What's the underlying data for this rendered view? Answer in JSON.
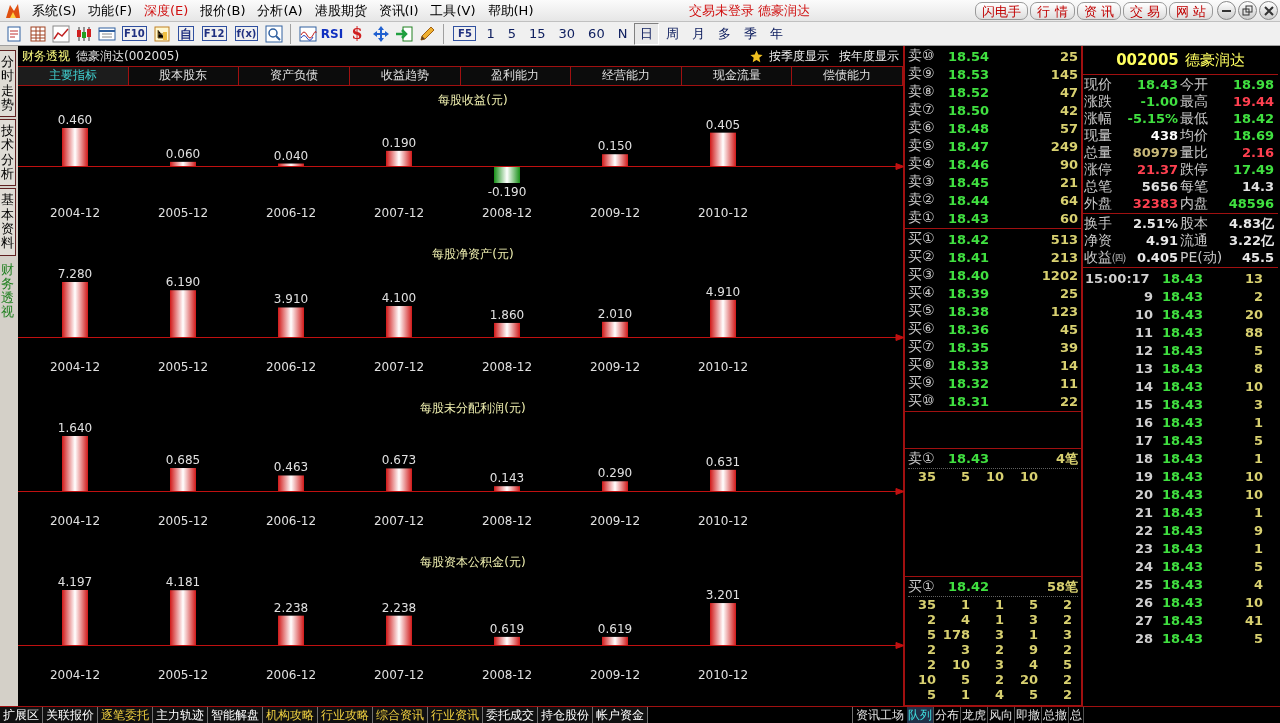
{
  "menu_bar": {
    "items": [
      {
        "label": "系统(S)",
        "highlighted": false
      },
      {
        "label": "功能(F)",
        "highlighted": false
      },
      {
        "label": "深度(E)",
        "highlighted": true
      },
      {
        "label": "报价(B)",
        "highlighted": false
      },
      {
        "label": "分析(A)",
        "highlighted": false
      },
      {
        "label": "港股期货",
        "highlighted": false
      },
      {
        "label": "资讯(I)",
        "highlighted": false
      },
      {
        "label": "工具(V)",
        "highlighted": false
      },
      {
        "label": "帮助(H)",
        "highlighted": false
      }
    ],
    "status": "交易未登录  德豪润达",
    "buttons": [
      "闪电手",
      "行 情",
      "资 讯",
      "交 易",
      "网 站"
    ]
  },
  "toolbar": {
    "labels": [
      "F10",
      "自",
      "F12",
      "f(x)",
      "RSI",
      "$",
      "F5"
    ],
    "periods": [
      {
        "label": "1",
        "selected": false
      },
      {
        "label": "5",
        "selected": false
      },
      {
        "label": "15",
        "selected": false
      },
      {
        "label": "30",
        "selected": false
      },
      {
        "label": "60",
        "selected": false
      },
      {
        "label": "N",
        "selected": false
      },
      {
        "label": "日",
        "selected": true
      },
      {
        "label": "周",
        "selected": false
      },
      {
        "label": "月",
        "selected": false
      },
      {
        "label": "多",
        "selected": false
      },
      {
        "label": "季",
        "selected": false
      },
      {
        "label": "年",
        "selected": false
      }
    ]
  },
  "side_tabs": [
    {
      "label": "分时走势",
      "selected": false
    },
    {
      "label": "技术分析",
      "selected": false
    },
    {
      "label": "基本资料",
      "selected": false
    },
    {
      "label": "财务透视",
      "selected": true
    }
  ],
  "finance": {
    "title": "财务透视",
    "stock": "德豪润达(002005)",
    "view_options": [
      {
        "label": "按季度显示",
        "selected": true
      },
      {
        "label": "按年度显示",
        "selected": false
      }
    ],
    "tabs": [
      {
        "label": "主要指标",
        "selected": true
      },
      {
        "label": "股本股东",
        "selected": false
      },
      {
        "label": "资产负债",
        "selected": false
      },
      {
        "label": "收益趋势",
        "selected": false
      },
      {
        "label": "盈利能力",
        "selected": false
      },
      {
        "label": "经营能力",
        "selected": false
      },
      {
        "label": "现金流量",
        "selected": false
      },
      {
        "label": "偿债能力",
        "selected": false
      }
    ],
    "charts": [
      {
        "chart_data": {
          "type": "bar",
          "title": "每股收益(元)",
          "categories": [
            "2004-12",
            "2005-12",
            "2006-12",
            "2007-12",
            "2008-12",
            "2009-12",
            "2010-12"
          ],
          "values": [
            0.46,
            0.06,
            0.04,
            0.19,
            -0.19,
            0.15,
            0.405
          ],
          "value_labels": [
            "0.460",
            "0.060",
            "0.040",
            "0.190",
            "-0.190",
            "0.150",
            "0.405"
          ]
        }
      },
      {
        "chart_data": {
          "type": "bar",
          "title": "每股净资产(元)",
          "categories": [
            "2004-12",
            "2005-12",
            "2006-12",
            "2007-12",
            "2008-12",
            "2009-12",
            "2010-12"
          ],
          "values": [
            7.28,
            6.19,
            3.91,
            4.1,
            1.86,
            2.01,
            4.91
          ],
          "value_labels": [
            "7.280",
            "6.190",
            "3.910",
            "4.100",
            "1.860",
            "2.010",
            "4.910"
          ]
        }
      },
      {
        "chart_data": {
          "type": "bar",
          "title": "每股未分配利润(元)",
          "categories": [
            "2004-12",
            "2005-12",
            "2006-12",
            "2007-12",
            "2008-12",
            "2009-12",
            "2010-12"
          ],
          "values": [
            1.64,
            0.685,
            0.463,
            0.673,
            0.143,
            0.29,
            0.631
          ],
          "value_labels": [
            "1.640",
            "0.685",
            "0.463",
            "0.673",
            "0.143",
            "0.290",
            "0.631"
          ]
        }
      },
      {
        "chart_data": {
          "type": "bar",
          "title": "每股资本公积金(元)",
          "categories": [
            "2004-12",
            "2005-12",
            "2006-12",
            "2007-12",
            "2008-12",
            "2009-12",
            "2010-12"
          ],
          "values": [
            4.197,
            4.181,
            2.238,
            2.238,
            0.619,
            0.619,
            3.201
          ],
          "value_labels": [
            "4.197",
            "4.181",
            "2.238",
            "2.238",
            "0.619",
            "0.619",
            "3.201"
          ]
        }
      }
    ]
  },
  "order_book": {
    "asks": [
      {
        "label": "卖⑩",
        "price": "18.54",
        "volume": "25"
      },
      {
        "label": "卖⑨",
        "price": "18.53",
        "volume": "145"
      },
      {
        "label": "卖⑧",
        "price": "18.52",
        "volume": "47"
      },
      {
        "label": "卖⑦",
        "price": "18.50",
        "volume": "42"
      },
      {
        "label": "卖⑥",
        "price": "18.48",
        "volume": "57"
      },
      {
        "label": "卖⑤",
        "price": "18.47",
        "volume": "249"
      },
      {
        "label": "卖④",
        "price": "18.46",
        "volume": "90"
      },
      {
        "label": "卖③",
        "price": "18.45",
        "volume": "21"
      },
      {
        "label": "卖②",
        "price": "18.44",
        "volume": "64"
      },
      {
        "label": "卖①",
        "price": "18.43",
        "volume": "60"
      }
    ],
    "bids": [
      {
        "label": "买①",
        "price": "18.42",
        "volume": "513"
      },
      {
        "label": "买②",
        "price": "18.41",
        "volume": "213"
      },
      {
        "label": "买③",
        "price": "18.40",
        "volume": "1202"
      },
      {
        "label": "买④",
        "price": "18.39",
        "volume": "25"
      },
      {
        "label": "买⑤",
        "price": "18.38",
        "volume": "123"
      },
      {
        "label": "买⑥",
        "price": "18.36",
        "volume": "45"
      },
      {
        "label": "买⑦",
        "price": "18.35",
        "volume": "39"
      },
      {
        "label": "买⑧",
        "price": "18.33",
        "volume": "14"
      },
      {
        "label": "买⑨",
        "price": "18.32",
        "volume": "11"
      },
      {
        "label": "买⑩",
        "price": "18.31",
        "volume": "22"
      }
    ],
    "ask_queue": {
      "label": "卖①",
      "price": "18.43",
      "count": "4笔",
      "orders": [
        [
          "35",
          "5",
          "10",
          "10"
        ]
      ]
    },
    "bid_queue": {
      "label": "买①",
      "price": "18.42",
      "count": "58笔",
      "orders": [
        [
          "35",
          "1",
          "1",
          "5",
          "2"
        ],
        [
          "2",
          "4",
          "1",
          "3",
          "2"
        ],
        [
          "5",
          "178",
          "3",
          "1",
          "3"
        ],
        [
          "2",
          "3",
          "2",
          "9",
          "2"
        ],
        [
          "2",
          "10",
          "3",
          "4",
          "5"
        ],
        [
          "10",
          "5",
          "2",
          "20",
          "2"
        ],
        [
          "5",
          "1",
          "4",
          "5",
          "2"
        ]
      ]
    }
  },
  "quote": {
    "code": "002005",
    "name": "德豪润达",
    "rows": [
      {
        "label": "现价",
        "value": "18.43",
        "color": "#40e040"
      },
      {
        "label": "今开",
        "value": "18.98",
        "color": "#40e040"
      },
      {
        "label": "涨跌",
        "value": "-1.00",
        "color": "#40e040"
      },
      {
        "label": "最高",
        "value": "19.44",
        "color": "#ff4050"
      },
      {
        "label": "涨幅",
        "value": "-5.15%",
        "color": "#40e040"
      },
      {
        "label": "最低",
        "value": "18.42",
        "color": "#40e040"
      },
      {
        "label": "现量",
        "value": "438",
        "color": "#ffffff"
      },
      {
        "label": "均价",
        "value": "18.69",
        "color": "#40e040"
      },
      {
        "label": "总量",
        "value": "80979",
        "color": "#c8b878"
      },
      {
        "label": "量比",
        "value": "2.16",
        "color": "#ff4050"
      },
      {
        "label": "涨停",
        "value": "21.37",
        "color": "#ff4050"
      },
      {
        "label": "跌停",
        "value": "17.49",
        "color": "#40e040"
      },
      {
        "label": "总笔",
        "value": "5656",
        "color": "#e0e0e0"
      },
      {
        "label": "每笔",
        "value": "14.3",
        "color": "#e0e0e0"
      },
      {
        "label": "外盘",
        "value": "32383",
        "color": "#ff4050"
      },
      {
        "label": "内盘",
        "value": "48596",
        "color": "#40e040"
      }
    ],
    "extra_rows": [
      {
        "label": "换手",
        "value": "2.51%"
      },
      {
        "label": "股本",
        "value": "4.83亿"
      },
      {
        "label": "净资",
        "value": "4.91"
      },
      {
        "label": "流通",
        "value": "3.22亿"
      },
      {
        "label": "收益㈣",
        "value": "0.405"
      },
      {
        "label": "PE(动)",
        "value": "45.5"
      }
    ],
    "ticks": [
      {
        "time": "15:00:17",
        "price": "18.43",
        "volume": "13"
      },
      {
        "time": "9",
        "price": "18.43",
        "volume": "2"
      },
      {
        "time": "10",
        "price": "18.43",
        "volume": "20"
      },
      {
        "time": "11",
        "price": "18.43",
        "volume": "88"
      },
      {
        "time": "12",
        "price": "18.43",
        "volume": "5"
      },
      {
        "time": "13",
        "price": "18.43",
        "volume": "8"
      },
      {
        "time": "14",
        "price": "18.43",
        "volume": "10"
      },
      {
        "time": "15",
        "price": "18.43",
        "volume": "3"
      },
      {
        "time": "16",
        "price": "18.43",
        "volume": "1"
      },
      {
        "time": "17",
        "price": "18.43",
        "volume": "5"
      },
      {
        "time": "18",
        "price": "18.43",
        "volume": "1"
      },
      {
        "time": "19",
        "price": "18.43",
        "volume": "10"
      },
      {
        "time": "20",
        "price": "18.43",
        "volume": "10"
      },
      {
        "time": "21",
        "price": "18.43",
        "volume": "1"
      },
      {
        "time": "22",
        "price": "18.43",
        "volume": "9"
      },
      {
        "time": "23",
        "price": "18.43",
        "volume": "1"
      },
      {
        "time": "24",
        "price": "18.43",
        "volume": "5"
      },
      {
        "time": "25",
        "price": "18.43",
        "volume": "4"
      },
      {
        "time": "26",
        "price": "18.43",
        "volume": "10"
      },
      {
        "time": "27",
        "price": "18.43",
        "volume": "41"
      },
      {
        "time": "28",
        "price": "18.43",
        "volume": "5"
      }
    ]
  },
  "bottom_bar": {
    "tabs": [
      {
        "label": "扩展区",
        "highlighted": false
      },
      {
        "label": "关联报价",
        "highlighted": false
      },
      {
        "label": "逐笔委托",
        "highlighted": true
      },
      {
        "label": "主力轨迹",
        "highlighted": false
      },
      {
        "label": "智能解盘",
        "highlighted": false
      },
      {
        "label": "机构攻略",
        "highlighted": true
      },
      {
        "label": "行业攻略",
        "highlighted": true
      },
      {
        "label": "综合资讯",
        "highlighted": true
      },
      {
        "label": "行业资讯",
        "highlighted": true
      },
      {
        "label": "委托成交",
        "highlighted": false
      },
      {
        "label": "持仓股份",
        "highlighted": false
      },
      {
        "label": "帐户资金",
        "highlighted": false
      }
    ],
    "info": "资讯工场",
    "panel_tabs": [
      {
        "label": "队列",
        "selected": true
      },
      {
        "label": "分布",
        "selected": false
      },
      {
        "label": "龙虎",
        "selected": false
      },
      {
        "label": "风向",
        "selected": false
      },
      {
        "label": "即撤",
        "selected": false
      },
      {
        "label": "总撤",
        "selected": false
      },
      {
        "label": "总",
        "selected": false
      }
    ]
  }
}
